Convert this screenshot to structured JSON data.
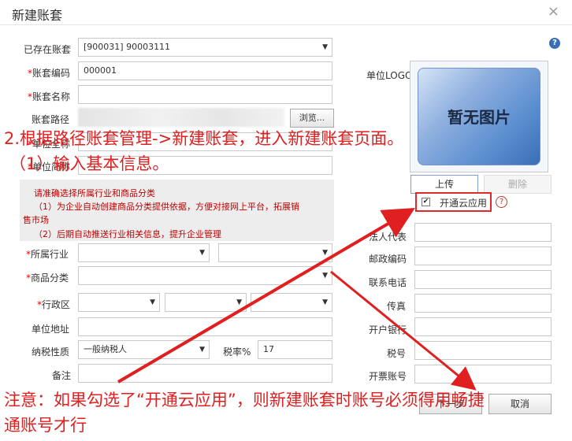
{
  "dialog": {
    "title": "新建账套",
    "close_glyph": "×",
    "help_glyph": "?"
  },
  "left_form": {
    "existing_label": "已存在账套",
    "existing_value": "[900031] 90003111",
    "code_label": "账套编码",
    "code_value": "000001",
    "name_label": "账套名称",
    "name_value": "",
    "path_label": "账套路径",
    "browse_label": "浏览...",
    "unit_name_label": "单位全称",
    "unit_short_label": "单位简称",
    "notice_lines": [
      "请准确选择所属行业和商品分类",
      "（1）为企业自动创建商品分类提供依据，方便对接网上平台，拓展销",
      "售市场",
      "（2）后期自动推送行业相关信息，提升企业管理"
    ],
    "industry_label": "所属行业",
    "category_label": "商品分类",
    "region_label": "行政区",
    "address_label": "单位地址",
    "taxpayer_label": "纳税性质",
    "taxpayer_value": "一般纳税人",
    "tax_rate_label": "税率%",
    "tax_rate_value": "17",
    "remark_label": "备注",
    "required_mark": "*"
  },
  "right_form": {
    "logo_label": "单位LOGO",
    "logo_placeholder": "暂无图片",
    "upload_label": "上传",
    "delete_label": "删除",
    "cloud_label": "开通云应用",
    "cloud_checked": true,
    "check_glyph": "✔",
    "question_glyph": "?",
    "legal_rep_label": "法人代表",
    "postal_label": "邮政编码",
    "phone_label": "联系电话",
    "fax_label": "传真",
    "bank_label": "开户银行",
    "tax_no_label": "税号",
    "invoice_label": "开票账号"
  },
  "footer": {
    "next_label": "下一步",
    "cancel_label": "取消"
  },
  "annotations": {
    "line1": "2.根据路径账套管理->新建账套，进入新建账套页面。",
    "line2": "（1）输入基本信息。",
    "line3": "注意：如果勾选了“开通云应用”，则新建账套时账号必须得用畅捷",
    "line4": "通账号才行",
    "color": "#e02020"
  }
}
